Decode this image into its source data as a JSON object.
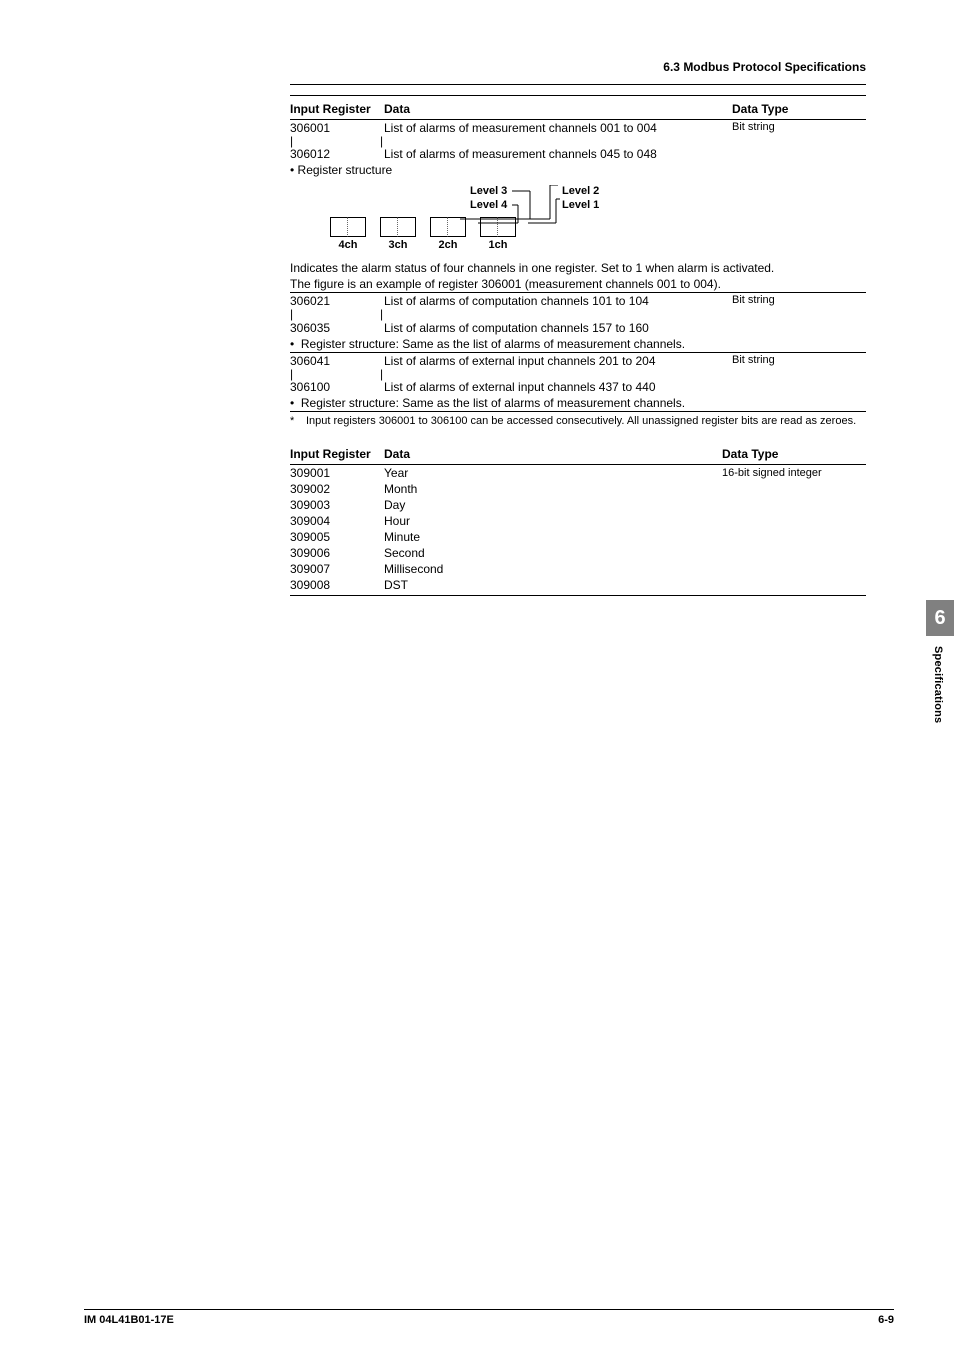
{
  "header": {
    "section_title": "6.3  Modbus Protocol Specifications"
  },
  "table1": {
    "head_register": "Input Register",
    "head_data": "Data",
    "head_type": "Data Type",
    "r1_reg": "306001",
    "r1_data": "List of alarms of measurement channels 001 to 004",
    "r1_type": "Bit string",
    "r2_reg": "306012",
    "r2_data": "List of alarms of measurement channels 045 to 048",
    "bullet1": "•   Register structure",
    "struct_level3": "Level 3",
    "struct_level4": "Level 4",
    "struct_level2": "Level 2",
    "struct_level1": "Level 1",
    "ch4": "4ch",
    "ch3": "3ch",
    "ch2": "2ch",
    "ch1": "1ch",
    "desc1": "Indicates the alarm status of four channels in one register.  Set to 1 when alarm is activated.",
    "desc2": "The figure is an example of register 306001 (measurement channels 001 to 004).",
    "r3_reg": "306021",
    "r3_data": "List of alarms of computation channels 101 to 104",
    "r3_type": "Bit string",
    "r4_reg": "306035",
    "r4_data": "List of alarms of computation channels 157 to 160",
    "bullet2": "Register structure: Same as the list of alarms of measurement channels.",
    "r5_reg": "306041",
    "r5_data": "List of alarms of external input channels 201 to 204",
    "r5_type": "Bit string",
    "r6_reg": "306100",
    "r6_data": "List of alarms of external input channels 437 to 440",
    "bullet3": "Register structure: Same as the list of alarms of measurement channels.",
    "footnote_ast": "*",
    "footnote": "Input registers 306001 to 306100 can be accessed consecutively. All unassigned register bits are read as zeroes."
  },
  "table2": {
    "head_register": "Input Register",
    "head_data": "Data",
    "head_type": "Data Type",
    "rows": [
      {
        "reg": "309001",
        "data": "Year",
        "type": "16-bit signed integer"
      },
      {
        "reg": "309002",
        "data": "Month",
        "type": ""
      },
      {
        "reg": "309003",
        "data": "Day",
        "type": ""
      },
      {
        "reg": "309004",
        "data": "Hour",
        "type": ""
      },
      {
        "reg": "309005",
        "data": "Minute",
        "type": ""
      },
      {
        "reg": "309006",
        "data": "Second",
        "type": ""
      },
      {
        "reg": "309007",
        "data": "Millisecond",
        "type": ""
      },
      {
        "reg": "309008",
        "data": "DST",
        "type": ""
      }
    ]
  },
  "sidebar": {
    "chapter": "6",
    "label": "Specifications"
  },
  "footer": {
    "left": "IM 04L41B01-17E",
    "right": "6-9"
  }
}
